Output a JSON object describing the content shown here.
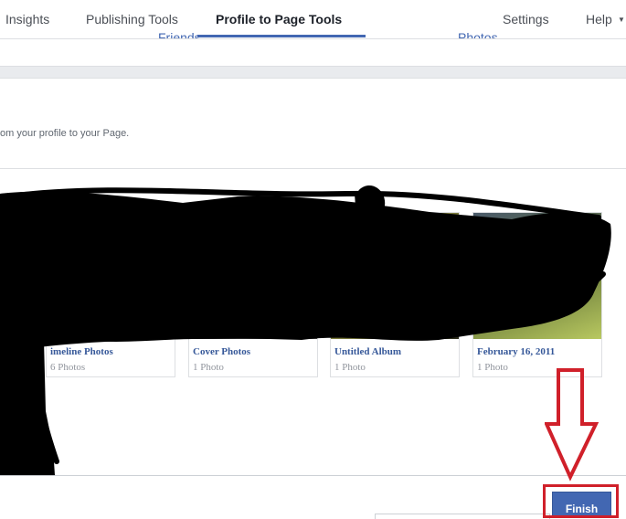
{
  "nav": {
    "tabs": [
      "Insights",
      "Publishing Tools",
      "Profile to Page Tools",
      "Settings",
      "Help"
    ],
    "active_tab": "Profile to Page Tools"
  },
  "subtabs": [
    "Friends",
    "Photos"
  ],
  "description": "om your profile to your Page.",
  "albums": [
    {
      "name": "imeline Photos",
      "count": "6 Photos"
    },
    {
      "name": "Cover Photos",
      "count": "1 Photo"
    },
    {
      "name": "Untitled Album",
      "count": "1 Photo"
    },
    {
      "name": "February 16, 2011",
      "count": "1 Photo"
    }
  ],
  "finish_label": "Finish",
  "colors": {
    "accent": "#4267b2",
    "annotation": "#d0202a",
    "redaction": "#000000"
  }
}
